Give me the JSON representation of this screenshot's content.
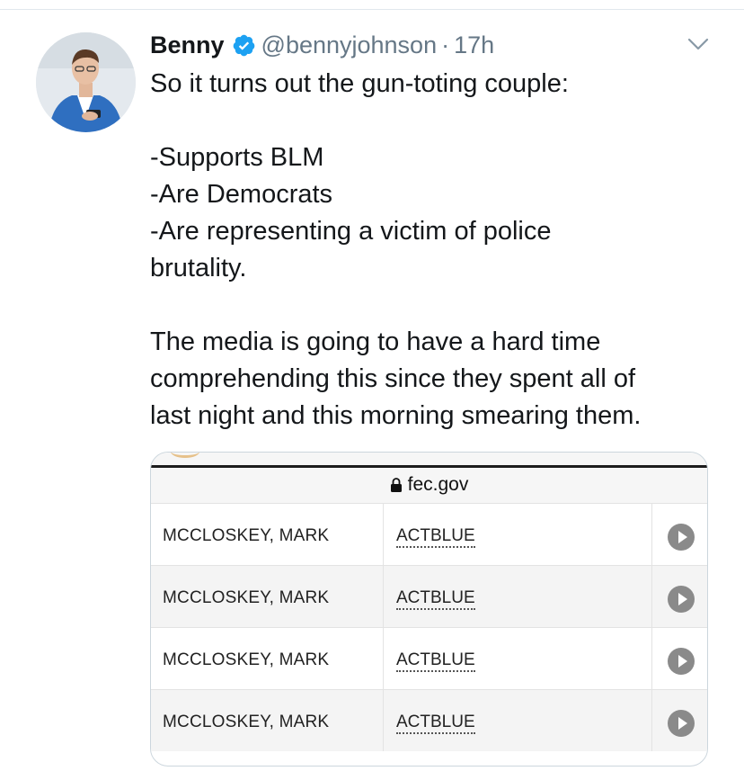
{
  "tweet": {
    "display_name": "Benny",
    "verified": true,
    "handle": "@bennyjohnson",
    "separator": "·",
    "time": "17h",
    "lines": [
      "So it turns out the gun-toting couple:",
      "",
      "-Supports BLM",
      "-Are Democrats",
      "-Are representing a victim of police",
      "brutality.",
      "",
      "The media is going to have a hard time",
      "comprehending this since they spent all of",
      "last night and this morning smearing them."
    ]
  },
  "media": {
    "url": "fec.gov",
    "rows": [
      {
        "name": "MCCLOSKEY, MARK",
        "committee": "ACTBLUE"
      },
      {
        "name": "MCCLOSKEY, MARK",
        "committee": "ACTBLUE"
      },
      {
        "name": "MCCLOSKEY, MARK",
        "committee": "ACTBLUE"
      },
      {
        "name": "MCCLOSKEY, MARK",
        "committee": "ACTBLUE"
      }
    ]
  },
  "colors": {
    "text": "#14171a",
    "secondary": "#657786",
    "verified_blue": "#1da1f2",
    "border": "#ccd6dd"
  },
  "icons": {
    "verified": "verified-badge-icon",
    "menu": "chevron-down-icon",
    "lock": "lock-icon",
    "play": "play-icon"
  }
}
